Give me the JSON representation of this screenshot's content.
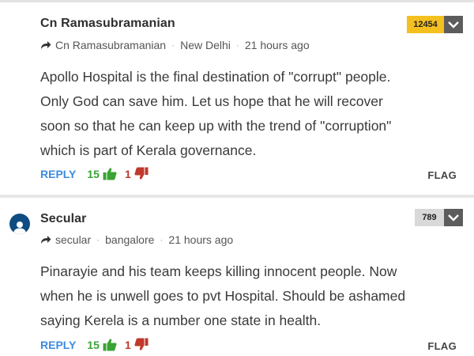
{
  "comments": [
    {
      "author": "Cn Ramasubramanian",
      "score": "12454",
      "meta": {
        "user": "Cn Ramasubramanian",
        "location": "New Delhi",
        "time": "21 hours ago"
      },
      "lines": [
        "Apollo Hospital is the final destination of \"corrupt\" people.",
        "Only God can save him. Let us hope that he will recover",
        "soon so that he can keep up with the trend of \"corruption\"",
        "which is part of Kerala governance."
      ],
      "reply_label": "REPLY",
      "upvotes": "15",
      "downvotes": "1",
      "flag_label": "FLAG"
    },
    {
      "author": "Secular",
      "score": "789",
      "meta": {
        "user": "secular",
        "location": "bangalore",
        "time": "21 hours ago"
      },
      "lines": [
        "Pinarayie and his team keeps killing innocent people. Now",
        "when he is unwell goes to pvt Hospital. Should be ashamed",
        "saying Kerela is a number one state in health."
      ],
      "reply_label": "REPLY",
      "upvotes": "15",
      "downvotes": "1",
      "flag_label": "FLAG"
    }
  ],
  "separator": "·",
  "colors": {
    "reply": "#3b8be0",
    "upvote": "#3aa335",
    "downvote": "#c0392b",
    "score_highlight": "#f4c020",
    "score_normal": "#d9d9d9",
    "avatar": "#0f4c81"
  },
  "icons": [
    "reply-arrow-icon",
    "thumbs-up-icon",
    "thumbs-down-icon",
    "chevron-down-icon",
    "user-avatar-icon"
  ]
}
